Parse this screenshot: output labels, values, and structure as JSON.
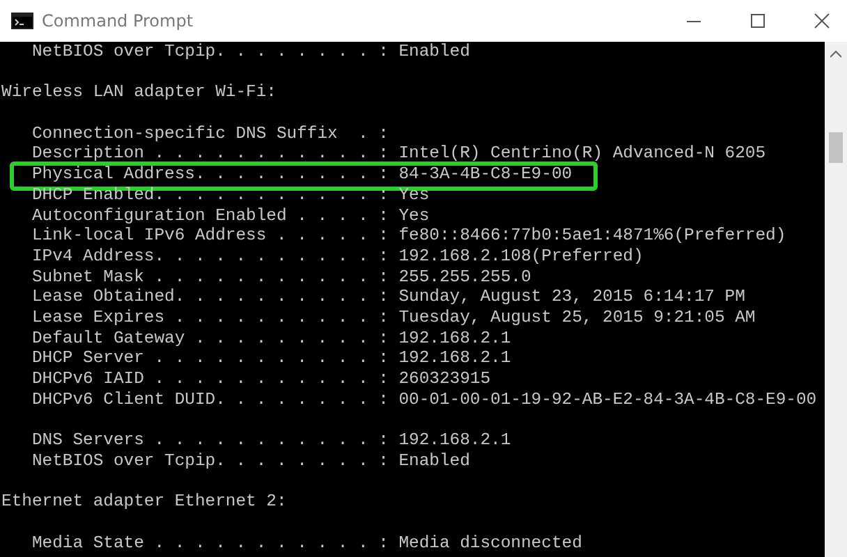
{
  "window": {
    "title": "Command Prompt"
  },
  "lines": [
    {
      "kind": "entry",
      "label": "   NetBIOS over Tcpip. . . . . . . . : ",
      "value": "Enabled",
      "highlighted": false
    },
    {
      "kind": "blank"
    },
    {
      "kind": "heading",
      "text": "Wireless LAN adapter Wi-Fi:"
    },
    {
      "kind": "blank"
    },
    {
      "kind": "entry",
      "label": "   Connection-specific DNS Suffix  . : ",
      "highlighted": false
    },
    {
      "kind": "entry",
      "label": "   Description . . . . . . . . . . . : ",
      "value": "Intel(R) Centrino(R) Advanced-N 6205",
      "highlighted": false
    },
    {
      "kind": "entry",
      "label": "   Physical Address. . . . . . . . . : ",
      "value": "84-3A-4B-C8-E9-00",
      "highlighted": true
    },
    {
      "kind": "entry",
      "label": "   DHCP Enabled. . . . . . . . . . . : ",
      "value": "Yes",
      "highlighted": false
    },
    {
      "kind": "entry",
      "label": "   Autoconfiguration Enabled . . . . : ",
      "value": "Yes",
      "highlighted": false
    },
    {
      "kind": "entry",
      "label": "   Link-local IPv6 Address . . . . . : ",
      "value": "fe80::8466:77b0:5ae1:4871%6(Preferred)",
      "highlighted": false
    },
    {
      "kind": "entry",
      "label": "   IPv4 Address. . . . . . . . . . . : ",
      "value": "192.168.2.108(Preferred)",
      "highlighted": false
    },
    {
      "kind": "entry",
      "label": "   Subnet Mask . . . . . . . . . . . : ",
      "value": "255.255.255.0",
      "highlighted": false
    },
    {
      "kind": "entry",
      "label": "   Lease Obtained. . . . . . . . . . : ",
      "value": "Sunday, August 23, 2015 6:14:17 PM",
      "highlighted": false
    },
    {
      "kind": "entry",
      "label": "   Lease Expires . . . . . . . . . . : ",
      "value": "Tuesday, August 25, 2015 9:21:05 AM",
      "highlighted": false
    },
    {
      "kind": "entry",
      "label": "   Default Gateway . . . . . . . . . : ",
      "value": "192.168.2.1",
      "highlighted": false
    },
    {
      "kind": "entry",
      "label": "   DHCP Server . . . . . . . . . . . : ",
      "value": "192.168.2.1",
      "highlighted": false
    },
    {
      "kind": "entry",
      "label": "   DHCPv6 IAID . . . . . . . . . . . : ",
      "value": "260323915",
      "highlighted": false
    },
    {
      "kind": "entry",
      "label": "   DHCPv6 Client DUID. . . . . . . . : ",
      "value": "00-01-00-01-19-92-AB-E2-84-3A-4B-C8-E9-00",
      "highlighted": false
    },
    {
      "kind": "blank"
    },
    {
      "kind": "entry",
      "label": "   DNS Servers . . . . . . . . . . . : ",
      "value": "192.168.2.1",
      "highlighted": false
    },
    {
      "kind": "entry",
      "label": "   NetBIOS over Tcpip. . . . . . . . : ",
      "value": "Enabled",
      "highlighted": false
    },
    {
      "kind": "blank"
    },
    {
      "kind": "heading",
      "text": "Ethernet adapter Ethernet 2:"
    },
    {
      "kind": "blank"
    },
    {
      "kind": "entry",
      "label": "   Media State . . . . . . . . . . . : ",
      "value": "Media disconnected",
      "highlighted": false
    }
  ]
}
